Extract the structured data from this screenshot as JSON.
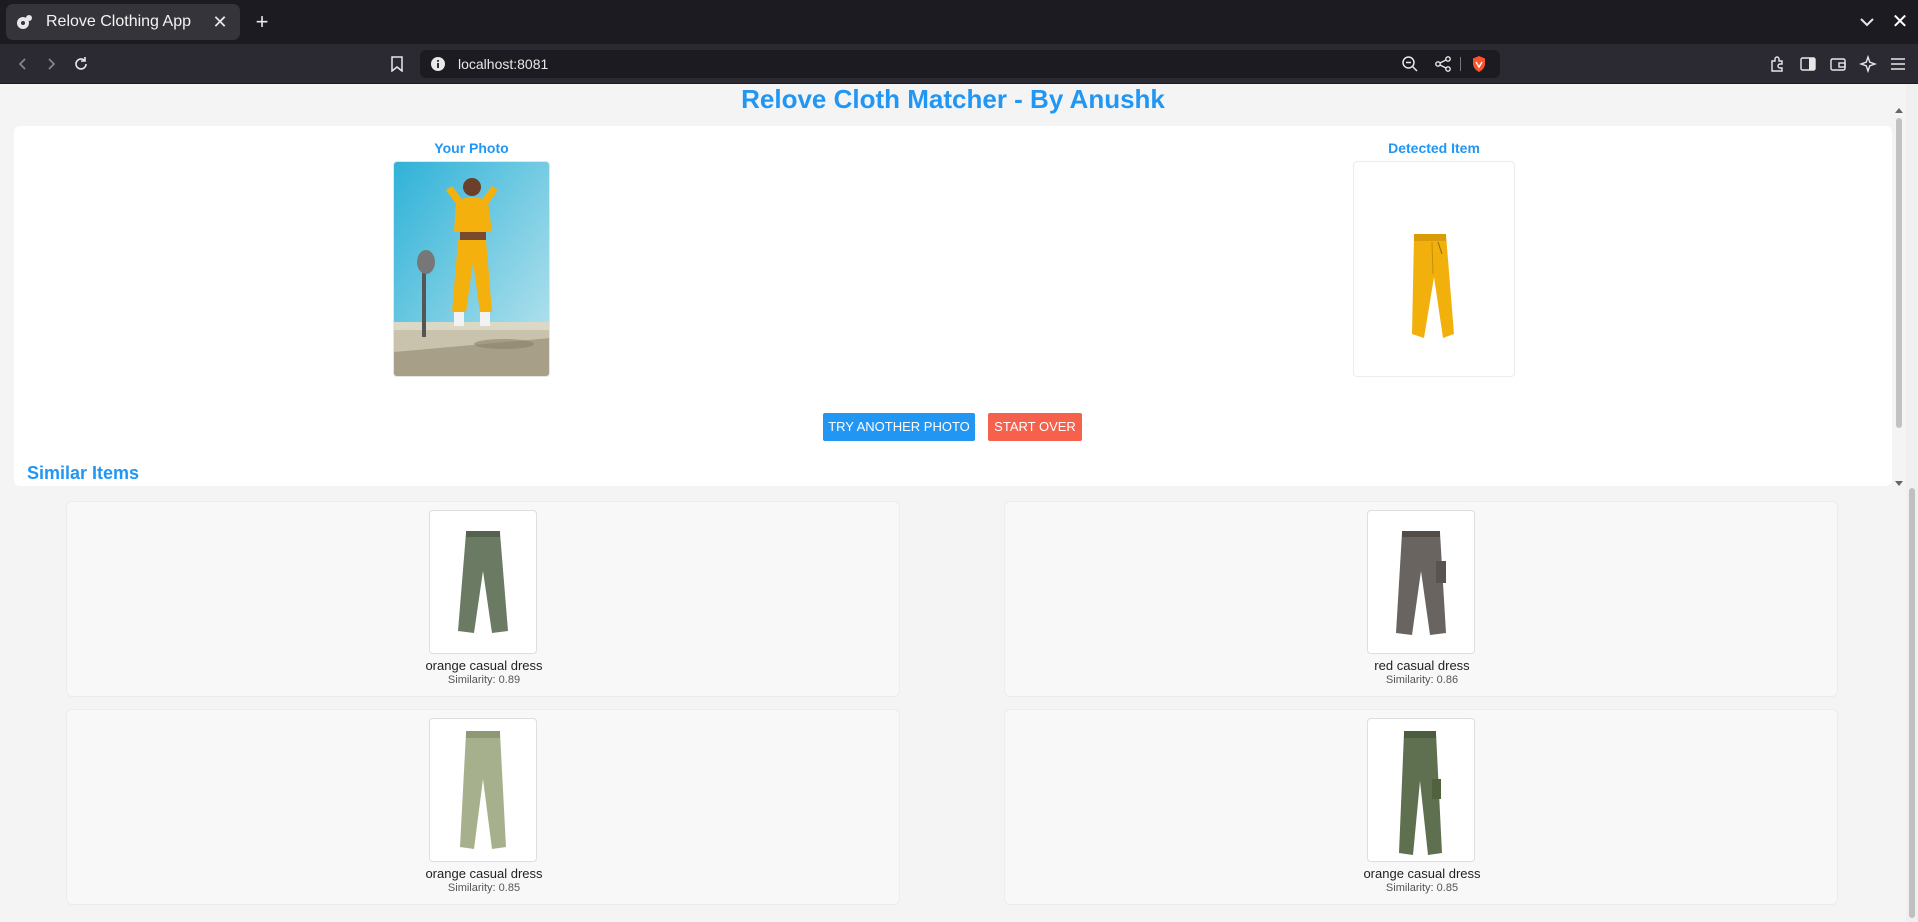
{
  "browser": {
    "tab_title": "Relove Clothing App",
    "url": "localhost:8081"
  },
  "page": {
    "title": "Relove Cloth Matcher - By Anushk",
    "your_photo_label": "Your Photo",
    "detected_label": "Detected Item",
    "try_button": "TRY ANOTHER PHOTO",
    "start_button": "START OVER",
    "similar_title": "Similar Items"
  },
  "similar_items": [
    {
      "name": "orange casual dress",
      "similarity": "Similarity: 0.89",
      "color": "#6b7a62"
    },
    {
      "name": "red casual dress",
      "similarity": "Similarity: 0.86",
      "color": "#6a6460"
    },
    {
      "name": "orange casual dress",
      "similarity": "Similarity: 0.85",
      "color": "#a7b08c"
    },
    {
      "name": "orange casual dress",
      "similarity": "Similarity: 0.85",
      "color": "#5f7050"
    }
  ],
  "colors": {
    "accent": "#2196f3",
    "danger": "#f5614d"
  }
}
